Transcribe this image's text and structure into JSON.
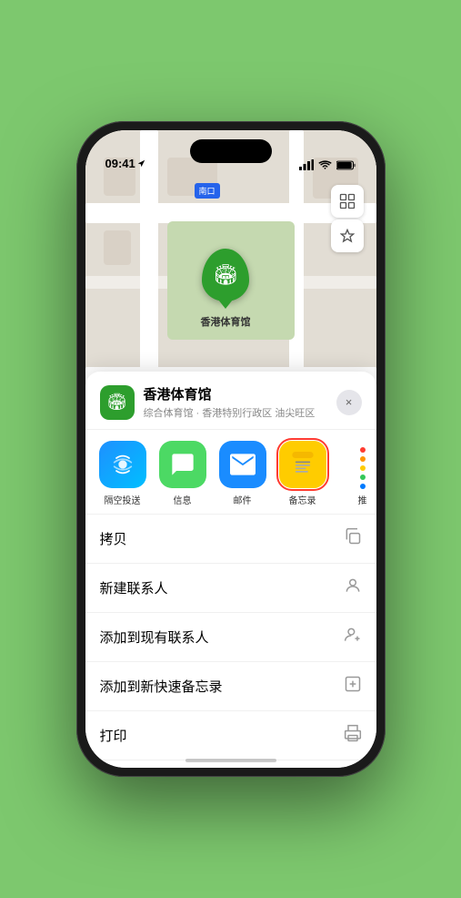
{
  "status_bar": {
    "time": "09:41",
    "location_arrow": "▶"
  },
  "map": {
    "label": "南口",
    "venue_name": "香港体育馆",
    "venue_subtitle_cn": "香港体育馆"
  },
  "venue_sheet": {
    "title": "香港体育馆",
    "subtitle": "综合体育馆 · 香港特别行政区 油尖旺区",
    "close_label": "×"
  },
  "share_items": [
    {
      "id": "airdrop",
      "label": "隔空投送",
      "bg": "#e8eaf6",
      "icon": "📡",
      "selected": false
    },
    {
      "id": "messages",
      "label": "信息",
      "bg": "#4cde60",
      "icon": "💬",
      "selected": false
    },
    {
      "id": "mail",
      "label": "邮件",
      "bg": "#1a8cff",
      "icon": "✉️",
      "selected": false
    },
    {
      "id": "notes",
      "label": "备忘录",
      "bg": "#ffcc00",
      "icon": "📝",
      "selected": true
    },
    {
      "id": "more",
      "label": "推",
      "bg": "transparent",
      "icon": "···",
      "selected": false
    }
  ],
  "actions": [
    {
      "id": "copy",
      "label": "拷贝",
      "icon": "📋"
    },
    {
      "id": "new-contact",
      "label": "新建联系人",
      "icon": "👤"
    },
    {
      "id": "add-existing",
      "label": "添加到现有联系人",
      "icon": "👤+"
    },
    {
      "id": "add-notes",
      "label": "添加到新快速备忘录",
      "icon": "🗒"
    },
    {
      "id": "print",
      "label": "打印",
      "icon": "🖨"
    }
  ]
}
